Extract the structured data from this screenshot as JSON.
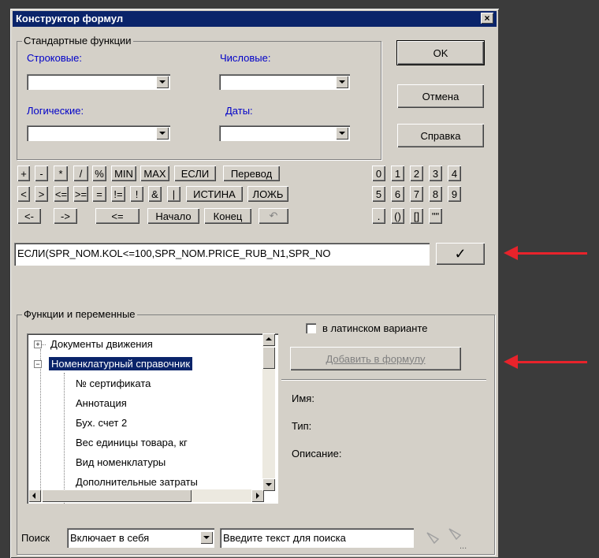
{
  "window": {
    "title": "Конструктор формул",
    "close_glyph": "×"
  },
  "std_functions": {
    "group_title": "Стандартные функции",
    "string_label": "Строковые:",
    "numeric_label": "Числовые:",
    "logical_label": "Логические:",
    "dates_label": "Даты:",
    "string_value": "",
    "numeric_value": "",
    "logical_value": "",
    "dates_value": ""
  },
  "buttons": {
    "ok": "OK",
    "cancel": "Отмена",
    "help": "Справка"
  },
  "keys": {
    "row1": [
      "+",
      "-",
      "*",
      "/",
      "%",
      "MIN",
      "MAX",
      "ЕСЛИ",
      "Перевод"
    ],
    "row2": [
      "<",
      ">",
      "<=",
      ">=",
      "=",
      "!=",
      "!",
      "&",
      "|",
      "ИСТИНА",
      "ЛОЖЬ"
    ],
    "row3": [
      "<-",
      "->",
      "<=",
      "Начало",
      "Конец",
      "↶"
    ],
    "digits1": [
      "0",
      "1",
      "2",
      "3",
      "4"
    ],
    "digits2": [
      "5",
      "6",
      "7",
      "8",
      "9"
    ],
    "brackets": [
      ".",
      "()",
      "[]",
      "\"\""
    ]
  },
  "formula": {
    "value": "ЕСЛИ(SPR_NOM.KOL<=100,SPR_NOM.PRICE_RUB_N1,SPR_NO",
    "apply_glyph": "✓"
  },
  "functions": {
    "group_title": "Функции и переменные",
    "latin_label": "в латинском варианте",
    "add_button": "Добавить в формулу",
    "name_label": "Имя:",
    "type_label": "Тип:",
    "desc_label": "Описание:",
    "tree": [
      {
        "label": "Документы движения",
        "expander": "+"
      },
      {
        "label": "Номенклатурный справочник",
        "expander": "−"
      },
      {
        "label": "№ сертификата"
      },
      {
        "label": "Аннотация"
      },
      {
        "label": "Бух. счет 2"
      },
      {
        "label": "Вес единицы товара, кг"
      },
      {
        "label": "Вид номенклатуры"
      },
      {
        "label": "Дополнительные затраты"
      }
    ]
  },
  "search": {
    "label": "Поиск",
    "mode": "Включает в себя",
    "placeholder": "Введите текст для поиска",
    "more": "..."
  },
  "colors": {
    "titlebar": "#0a246a",
    "annotation_arrow": "#e8232b",
    "label_blue": "#0000c8"
  }
}
